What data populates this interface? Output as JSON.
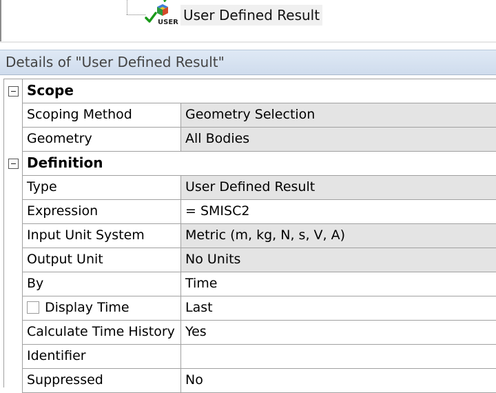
{
  "tree": {
    "node_label": "User Defined Result",
    "node_icon": "user-defined-result-icon",
    "icon_badge_text": "USER"
  },
  "details": {
    "header_title": "Details of \"User Defined Result\""
  },
  "sections": {
    "scope": {
      "title": "Scope",
      "rows": [
        {
          "label": "Scoping Method",
          "value": "Geometry Selection"
        },
        {
          "label": "Geometry",
          "value": "All Bodies"
        }
      ]
    },
    "definition": {
      "title": "Definition",
      "rows": [
        {
          "label": "Type",
          "value": "User Defined Result"
        },
        {
          "label": "Expression",
          "value": "= SMISC2"
        },
        {
          "label": "Input Unit System",
          "value": "Metric (m, kg, N, s, V, A)"
        },
        {
          "label": "Output Unit",
          "value": "No Units"
        },
        {
          "label": "By",
          "value": "Time"
        },
        {
          "label": "Display Time",
          "value": "Last",
          "checkbox_checked": false
        },
        {
          "label": "Calculate Time History",
          "value": "Yes"
        },
        {
          "label": "Identifier",
          "value": ""
        },
        {
          "label": "Suppressed",
          "value": "No"
        }
      ]
    }
  },
  "colors": {
    "header_bg": "#cfdced",
    "readonly_cell": "#e4e4e4",
    "grid_line": "#a0a0a0",
    "check_green": "#1a9a1a"
  }
}
